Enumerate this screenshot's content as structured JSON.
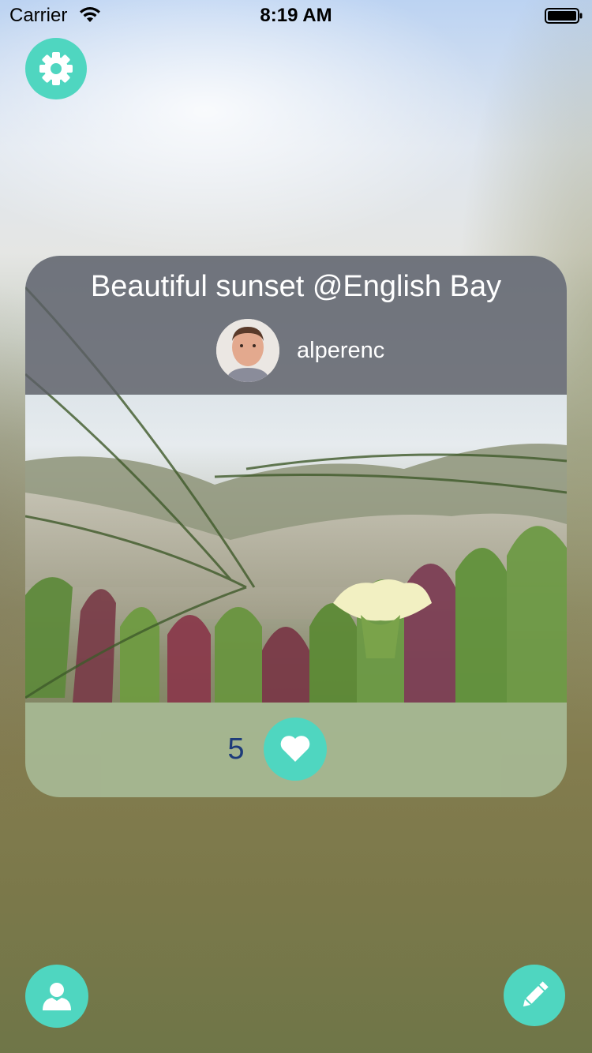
{
  "status_bar": {
    "carrier": "Carrier",
    "time": "8:19 AM",
    "icons": [
      "wifi-icon",
      "battery-icon"
    ]
  },
  "toolbar": {
    "settings_icon": "gear-icon",
    "profile_icon": "person-icon",
    "compose_icon": "pencil-icon"
  },
  "post": {
    "title": "Beautiful sunset @English Bay",
    "author": "alperenc",
    "likes": "5",
    "like_icon": "heart-icon"
  },
  "colors": {
    "accent": "#4fd6c0",
    "like_count": "#1d3b7a",
    "header_overlay": "#5c5e66"
  }
}
